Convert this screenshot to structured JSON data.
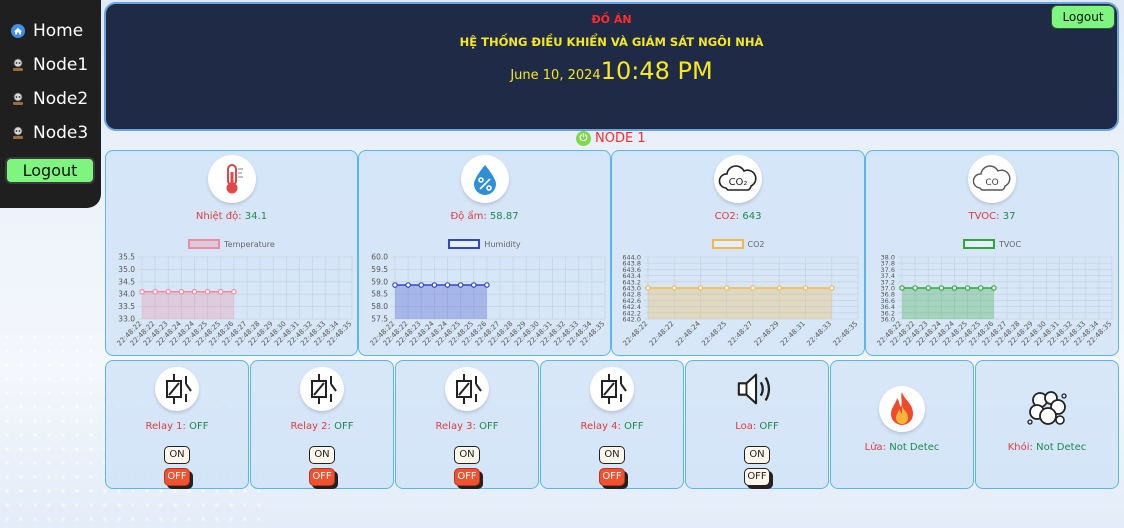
{
  "sidebar": {
    "items": [
      {
        "label": "Home",
        "icon": "home-icon"
      },
      {
        "label": "Node1",
        "icon": "node-icon"
      },
      {
        "label": "Node2",
        "icon": "node-icon"
      },
      {
        "label": "Node3",
        "icon": "node-icon"
      }
    ],
    "logout_label": "Logout"
  },
  "header": {
    "title1": "ĐỒ ÁN",
    "title2": "HỆ THỐNG ĐIỀU KHIỂN VÀ GIÁM SÁT NGÔI NHÀ",
    "date": "June 10, 2024",
    "time": "10:48 PM",
    "logout_label": "Logout"
  },
  "node": {
    "label": "NODE 1"
  },
  "sensors": [
    {
      "label": "Nhiệt độ:",
      "value": "34.1",
      "icon": "thermometer-icon",
      "legend": "Temperature"
    },
    {
      "label": "Độ ẩm:",
      "value": "58.87",
      "icon": "humidity-drop-icon",
      "legend": "Humidity"
    },
    {
      "label": "CO2:",
      "value": "643",
      "icon": "co2-cloud-icon",
      "legend": "CO2"
    },
    {
      "label": "TVOC:",
      "value": "37",
      "icon": "co-cloud-icon",
      "legend": "TVOC"
    }
  ],
  "chart_data": [
    {
      "type": "area",
      "title": "",
      "series": [
        {
          "name": "Temperature",
          "values": [
            34.1,
            34.1,
            34.1,
            34.1,
            34.1,
            34.1,
            34.1,
            34.1
          ]
        }
      ],
      "x": [
        "22:48:22",
        "22:48:22",
        "22:48:23",
        "22:48:24",
        "22:48:24",
        "22:48:25",
        "22:48:25",
        "22:48:26",
        "22:48:27",
        "22:48:28",
        "22:48:29",
        "22:48:30",
        "22:48:31",
        "22:48:32",
        "22:48:33",
        "22:48:34",
        "22:48:35"
      ],
      "y_ticks": [
        "35.5",
        "35.0",
        "34.5",
        "34.0",
        "33.5",
        "33.0"
      ],
      "ylim": [
        33.0,
        35.5
      ],
      "color": "#f08aa0",
      "grid": true,
      "legend": "top"
    },
    {
      "type": "area",
      "title": "",
      "series": [
        {
          "name": "Humidity",
          "values": [
            58.87,
            58.87,
            58.87,
            58.87,
            58.87,
            58.87,
            58.87,
            58.87
          ]
        }
      ],
      "x": [
        "22:48:22",
        "22:48:22",
        "22:48:23",
        "22:48:24",
        "22:48:24",
        "22:48:25",
        "22:48:25",
        "22:48:26",
        "22:48:27",
        "22:48:28",
        "22:48:29",
        "22:48:30",
        "22:48:31",
        "22:48:32",
        "22:48:33",
        "22:48:34",
        "22:48:35"
      ],
      "y_ticks": [
        "60.0",
        "59.5",
        "59.0",
        "58.5",
        "58.0",
        "57.5"
      ],
      "ylim": [
        57.5,
        60.0
      ],
      "color": "#3446c7",
      "grid": true,
      "legend": "top"
    },
    {
      "type": "area",
      "title": "",
      "series": [
        {
          "name": "CO2",
          "values": [
            643,
            643,
            643,
            643,
            643,
            643,
            643,
            643
          ]
        }
      ],
      "x": [
        "22:48:22",
        "22:48:22",
        "22:48:24",
        "22:48:25",
        "22:48:27",
        "22:48:29",
        "22:48:31",
        "22:48:33",
        "22:48:35"
      ],
      "y_ticks": [
        "644.0",
        "643.8",
        "643.6",
        "643.4",
        "643.2",
        "643.0",
        "642.8",
        "642.6",
        "642.4",
        "642.2",
        "642.0"
      ],
      "ylim": [
        642.0,
        644.0
      ],
      "color": "#f2b84b",
      "grid": true,
      "legend": "top"
    },
    {
      "type": "area",
      "title": "",
      "series": [
        {
          "name": "TVOC",
          "values": [
            37,
            37,
            37,
            37,
            37,
            37,
            37,
            37
          ]
        }
      ],
      "x": [
        "22:48:22",
        "22:48:22",
        "22:48:23",
        "22:48:24",
        "22:48:24",
        "22:48:25",
        "22:48:25",
        "22:48:26",
        "22:48:27",
        "22:48:28",
        "22:48:29",
        "22:48:30",
        "22:48:31",
        "22:48:32",
        "22:48:33",
        "22:48:34",
        "22:48:35"
      ],
      "y_ticks": [
        "38.0",
        "37.8",
        "37.6",
        "37.4",
        "37.2",
        "37.0",
        "36.8",
        "36.6",
        "36.4",
        "36.2",
        "36.0"
      ],
      "ylim": [
        36.0,
        38.0
      ],
      "color": "#2fa83a",
      "grid": true,
      "legend": "top"
    }
  ],
  "actuators": [
    {
      "label": "Relay 1:",
      "state": "OFF",
      "icon": "relay-icon",
      "on": "ON",
      "off": "OFF"
    },
    {
      "label": "Relay 2:",
      "state": "OFF",
      "icon": "relay-icon",
      "on": "ON",
      "off": "OFF"
    },
    {
      "label": "Relay 3:",
      "state": "OFF",
      "icon": "relay-icon",
      "on": "ON",
      "off": "OFF"
    },
    {
      "label": "Relay 4:",
      "state": "OFF",
      "icon": "relay-icon",
      "on": "ON",
      "off": "OFF"
    },
    {
      "label": "Loa:",
      "state": "OFF",
      "icon": "speaker-icon",
      "on": "ON",
      "off": "OFF"
    }
  ],
  "alarms": [
    {
      "label": "Lửa:",
      "state": "Not Detec",
      "icon": "fire-icon"
    },
    {
      "label": "Khói:",
      "state": "Not Detec",
      "icon": "smoke-icon"
    }
  ],
  "colors": {
    "accent_green": "#7ef57e",
    "header_bg": "#1f2a47",
    "label_red": "#e53b3b",
    "value_green": "#1f8a4c",
    "card_border": "#5ab7ea"
  }
}
